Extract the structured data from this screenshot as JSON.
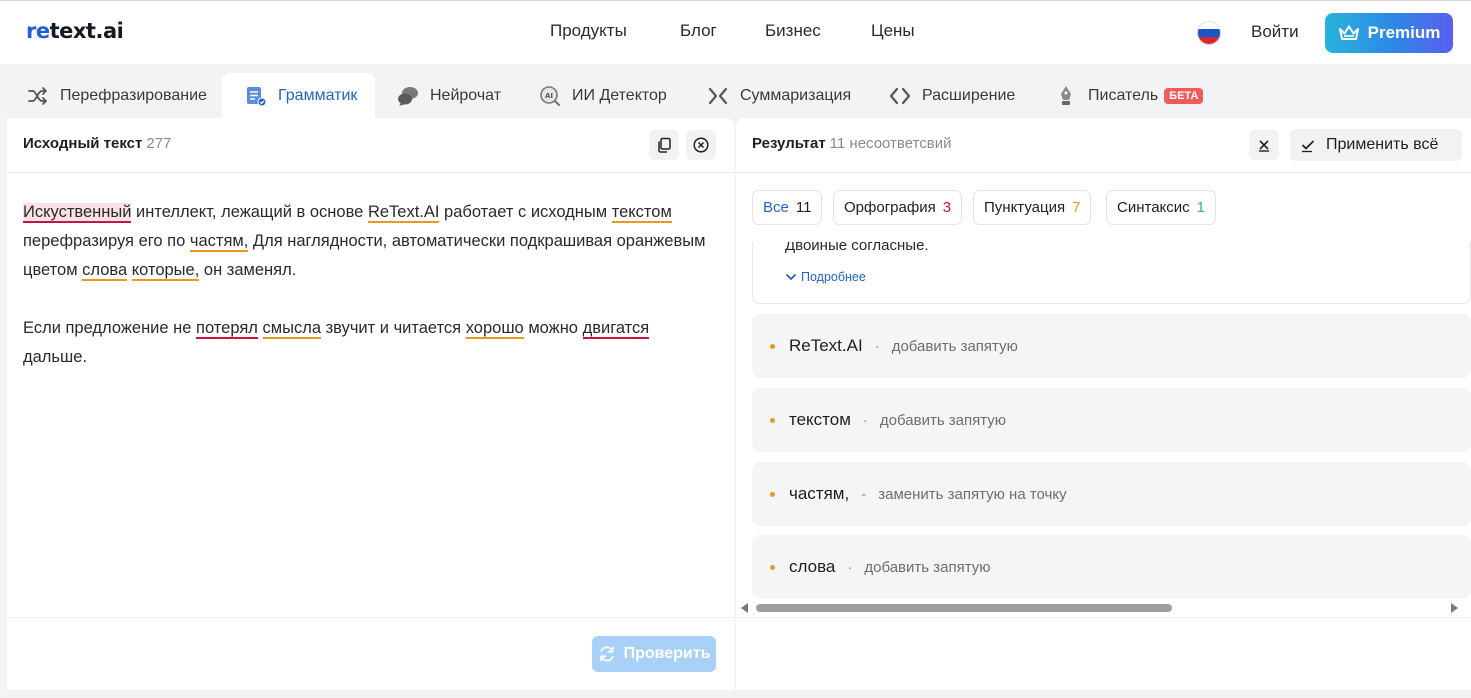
{
  "header": {
    "logo_prefix": "re",
    "logo_rest": "text.ai",
    "nav": [
      "Продукты",
      "Блог",
      "Бизнес",
      "Цены"
    ],
    "flag": "russia-flag-icon",
    "login": "Войти",
    "premium": "Premium"
  },
  "tabs": [
    {
      "label": "Перефразирование",
      "icon": "shuffle-icon"
    },
    {
      "label": "Грамматик",
      "icon": "grammar-document-icon",
      "active": true
    },
    {
      "label": "Нейрочат",
      "icon": "chat-bubbles-icon"
    },
    {
      "label": "ИИ Детектор",
      "icon": "ai-detector-icon"
    },
    {
      "label": "Суммаризация",
      "icon": "summarize-icon"
    },
    {
      "label": "Расширение",
      "icon": "expand-code-icon"
    },
    {
      "label": "Писатель",
      "icon": "pen-nib-icon",
      "badge": "БЕТА"
    }
  ],
  "source": {
    "title": "Исходный текст",
    "count": "277",
    "p1": {
      "w1": "Искуственный",
      "t1": " интеллект, лежащий в основе ",
      "w2": "ReText.AI",
      "t2": " работает с исходным ",
      "w3": "текстом",
      "t3": " перефразируя его по ",
      "w4": "частям,",
      "t4": " Для наглядности, автоматически подкрашивая оранжевым цветом ",
      "w5": "слова",
      "t5": " ",
      "w6": "которые,",
      "t6": " он заменял."
    },
    "p2": {
      "t1": "Если предложение не ",
      "w1": "потерял",
      "t2": " ",
      "w2": "смысла",
      "t3": " звучит и читается ",
      "w3": "хорошо",
      "t4": " можно ",
      "w4": "двигатся",
      "t5": " дальше."
    },
    "check_button": "Проверить"
  },
  "result": {
    "title": "Результат",
    "count": "11 несоответсвий",
    "apply_all": "Применить всё",
    "filters": [
      {
        "label": "Все",
        "count": "11",
        "color": "#1f1f1f"
      },
      {
        "label": "Орфография",
        "count": "3",
        "color": "#c8153f"
      },
      {
        "label": "Пунктуация",
        "count": "7",
        "color": "#e79a1f"
      },
      {
        "label": "Синтаксис",
        "count": "1",
        "color": "#2bb673"
      }
    ],
    "expanded": {
      "description": "Двоиные согласные.",
      "more": "Подробнее"
    },
    "items": [
      {
        "word": "ReText.AI",
        "sep": "·",
        "action": "добавить запятую"
      },
      {
        "word": "текстом",
        "sep": "·",
        "action": "добавить запятую"
      },
      {
        "word": "частям,",
        "sep": "-",
        "action": "заменить запятую на точку"
      },
      {
        "word": "слова",
        "sep": "·",
        "action": "добавить запятую"
      }
    ]
  }
}
